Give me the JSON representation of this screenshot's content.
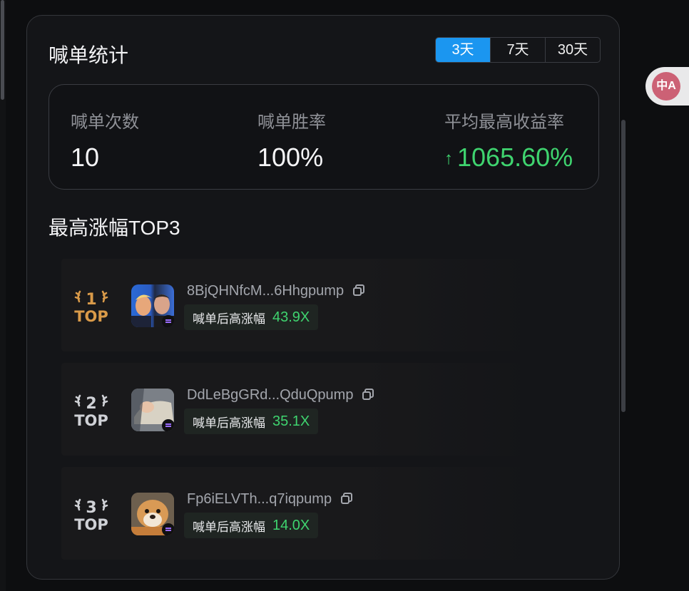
{
  "panel": {
    "title": "喊单统计",
    "periods": [
      "3天",
      "7天",
      "30天"
    ],
    "active_period": "3天"
  },
  "stats": {
    "calls_label": "喊单次数",
    "calls_value": "10",
    "winrate_label": "喊单胜率",
    "winrate_value": "100%",
    "avg_label": "平均最高收益率",
    "avg_value": "1065.60%"
  },
  "top3": {
    "title": "最高涨幅TOP3",
    "items": [
      {
        "rank": "1",
        "badge_text": "TOP",
        "address": "8BjQHNfcM...6Hhgpump",
        "gain_label": "喊单后高涨幅",
        "gain_value": "43.9X"
      },
      {
        "rank": "2",
        "badge_text": "TOP",
        "address": "DdLeBgGRd...QduQpump",
        "gain_label": "喊单后高涨幅",
        "gain_value": "35.1X"
      },
      {
        "rank": "3",
        "badge_text": "TOP",
        "address": "Fp6iELVTh...q7iqpump",
        "gain_label": "喊单后高涨幅",
        "gain_value": "14.0X"
      }
    ]
  },
  "translate_glyph": "中A",
  "colors": {
    "accent": "#1b96f0",
    "up_green": "#3fd46f",
    "gold": "#d99a49",
    "silver": "#cfd1d6"
  },
  "icons": [
    "arrow-up-icon",
    "copy-icon",
    "laurel-badge-icon",
    "solana-chain-icon",
    "translate-icon"
  ]
}
